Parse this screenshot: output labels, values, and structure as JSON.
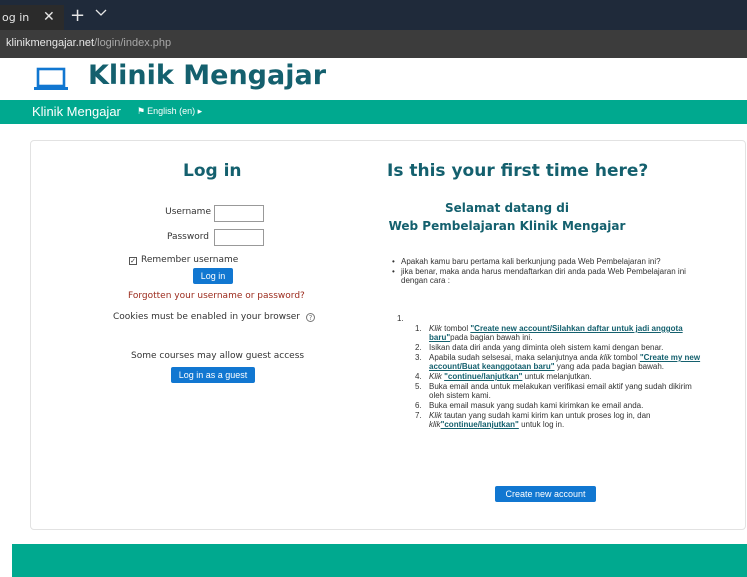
{
  "browser": {
    "tab_title": "og in",
    "tab_close": "✕",
    "new_tab": "+",
    "url_host": "klinikmengajar.net",
    "url_path": "/login/index.php"
  },
  "site": {
    "title": "Klinik Mengajar",
    "nav_brand": "Klinik Mengajar",
    "language": "English (en)"
  },
  "login": {
    "title": "Log in",
    "username_label": "Username",
    "password_label": "Password",
    "username_value": "",
    "password_value": "",
    "remember_label": "Remember username",
    "remember_checked": true,
    "login_button": "Log in",
    "forgot_link": "Forgotten your username or password?",
    "cookies_note": "Cookies must be enabled in your browser",
    "guest_note": "Some courses may allow guest access",
    "guest_button": "Log in as a guest"
  },
  "signup": {
    "title": "Is this your first time here?",
    "welcome_line1": "Selamat datang di",
    "welcome_line2": "Web Pembelajaran Klinik Mengajar",
    "bullet1": "Apakah kamu baru pertama kali berkunjung pada Web Pembelajaran ini?",
    "bullet2": "jika benar, maka anda harus mendaftarkan diri anda pada Web Pembelajaran ini dengan cara :",
    "list_start": "1.",
    "step1_pre": "tombol",
    "step1_italic": "Klik",
    "step1_link": "\"Create new account/Silahkan daftar untuk jadi anggota baru\"",
    "step1_post": "pada bagian bawah ini.",
    "step2": "Isikan data diri anda yang diminta oleh sistem kami dengan benar.",
    "step3_pre": "Apabila sudah selsesai, maka selanjutnya anda",
    "step3_italic": "klik",
    "step3_mid": "tombol",
    "step3_link": "\"Create my new account/Buat keanggotaan baru\"",
    "step3_post": "yang ada pada bagian bawah.",
    "step4_italic": "Klik",
    "step4_link": "\"continue/lanjutkan\"",
    "step4_post": "untuk melanjutkan.",
    "step5": "Buka email anda untuk melakukan verifikasi email aktif yang sudah dikirim oleh sistem kami.",
    "step6": "Buka email masuk yang sudah kami kirimkan ke email anda.",
    "step7_italic": "Klik",
    "step7_pre": "tautan yang sudah kami kirim kan untuk proses log in, dan",
    "step7_italic2": "klik",
    "step7_link": "\"continue/lanjutkan\"",
    "step7_post": "untuk log in.",
    "create_button": "Create new account"
  }
}
